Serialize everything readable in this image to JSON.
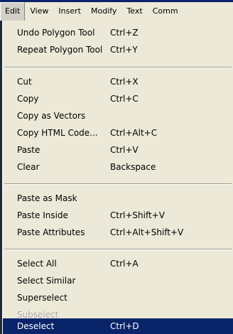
{
  "menubar": {
    "items": [
      {
        "label": "Edit"
      },
      {
        "label": "View"
      },
      {
        "label": "Insert"
      },
      {
        "label": "Modify"
      },
      {
        "label": "Text"
      },
      {
        "label": "Comm"
      }
    ]
  },
  "edit_menu": {
    "items": [
      {
        "label": "Undo Polygon Tool",
        "shortcut": "Ctrl+Z"
      },
      {
        "label": "Repeat Polygon Tool",
        "shortcut": "Ctrl+Y"
      },
      {
        "label": "Cut",
        "shortcut": "Ctrl+X"
      },
      {
        "label": "Copy",
        "shortcut": "Ctrl+C"
      },
      {
        "label": "Copy as Vectors",
        "shortcut": ""
      },
      {
        "label": "Copy HTML Code...",
        "shortcut": "Ctrl+Alt+C"
      },
      {
        "label": "Paste",
        "shortcut": "Ctrl+V"
      },
      {
        "label": "Clear",
        "shortcut": "Backspace"
      },
      {
        "label": "Paste as Mask",
        "shortcut": ""
      },
      {
        "label": "Paste Inside",
        "shortcut": "Ctrl+Shift+V"
      },
      {
        "label": "Paste Attributes",
        "shortcut": "Ctrl+Alt+Shift+V"
      },
      {
        "label": "Select All",
        "shortcut": "Ctrl+A"
      },
      {
        "label": "Select Similar",
        "shortcut": ""
      },
      {
        "label": "Superselect",
        "shortcut": ""
      },
      {
        "label": "Subselect",
        "shortcut": "",
        "state": "disabled"
      },
      {
        "label": "Deselect",
        "shortcut": "Ctrl+D",
        "state": "highlighted"
      }
    ]
  },
  "colors": {
    "menu_background": "#ece9d8",
    "highlight": "#0a246a",
    "disabled_text": "#a7a39a"
  }
}
